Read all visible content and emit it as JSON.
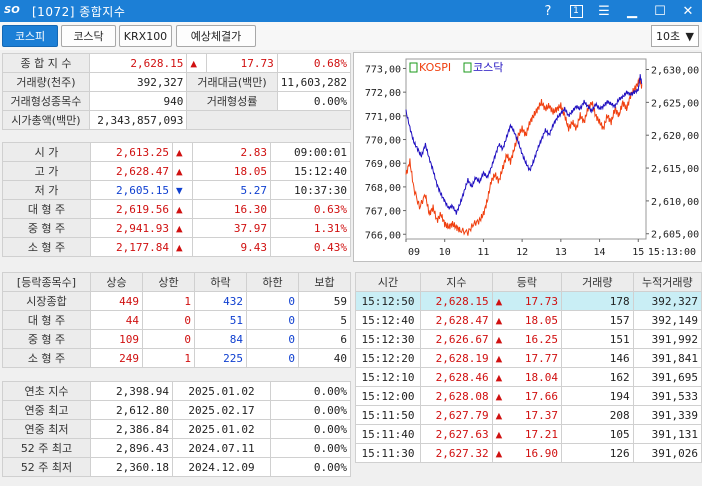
{
  "window": {
    "logo": "SO",
    "title": "[1072] 종합지수",
    "help": "?",
    "one": "1"
  },
  "tabs": [
    "코스피",
    "코스닥",
    "KRX100",
    "예상체결가"
  ],
  "interval": "10초",
  "summary": {
    "rows": [
      [
        "종 합 지 수",
        "2,628.15",
        "▲",
        "17.73",
        "0.68%"
      ],
      [
        "거래량(천주)",
        "392,327",
        "거래대금(백만)",
        "11,603,282"
      ],
      [
        "거래형성종목수",
        "940",
        "거래형성률",
        "0.00%"
      ],
      [
        "시가총액(백만)",
        "2,343,857,093"
      ]
    ]
  },
  "ohlc": [
    [
      "시      가",
      "2,613.25",
      "▲",
      "2.83",
      "09:00:01"
    ],
    [
      "고      가",
      "2,628.47",
      "▲",
      "18.05",
      "15:12:40"
    ],
    [
      "저      가",
      "2,605.15",
      "▼",
      "5.27",
      "10:37:30"
    ],
    [
      "대 형 주",
      "2,619.56",
      "▲",
      "16.30",
      "0.63%"
    ],
    [
      "중 형 주",
      "2,941.93",
      "▲",
      "37.97",
      "1.31%"
    ],
    [
      "소 형 주",
      "2,177.84",
      "▲",
      "9.43",
      "0.43%"
    ]
  ],
  "breadth": {
    "headers": [
      "[등락종목수]",
      "상승",
      "상한",
      "하락",
      "하한",
      "보합"
    ],
    "rows": [
      [
        "시장종합",
        "449",
        "1",
        "432",
        "0",
        "59"
      ],
      [
        "대 형 주",
        "44",
        "0",
        "51",
        "0",
        "5"
      ],
      [
        "중 형 주",
        "109",
        "0",
        "84",
        "0",
        "6"
      ],
      [
        "소 형 주",
        "249",
        "1",
        "225",
        "0",
        "40"
      ]
    ]
  },
  "annual": [
    [
      "연초  지수",
      "2,398.94",
      "2025.01.02",
      "0.00%"
    ],
    [
      "연중  최고",
      "2,612.80",
      "2025.02.17",
      "0.00%"
    ],
    [
      "연중  최저",
      "2,386.84",
      "2025.01.02",
      "0.00%"
    ],
    [
      "52 주 최고",
      "2,896.43",
      "2024.07.11",
      "0.00%"
    ],
    [
      "52 주 최저",
      "2,360.18",
      "2024.12.09",
      "0.00%"
    ]
  ],
  "ticks": {
    "headers": [
      "시간",
      "지수",
      "등락",
      "거래량",
      "누적거래량"
    ],
    "rows": [
      [
        "15:12:50",
        "2,628.15",
        "▲",
        "17.73",
        "178",
        "392,327"
      ],
      [
        "15:12:40",
        "2,628.47",
        "▲",
        "18.05",
        "157",
        "392,149"
      ],
      [
        "15:12:30",
        "2,626.67",
        "▲",
        "16.25",
        "151",
        "391,992"
      ],
      [
        "15:12:20",
        "2,628.19",
        "▲",
        "17.77",
        "146",
        "391,841"
      ],
      [
        "15:12:10",
        "2,628.46",
        "▲",
        "18.04",
        "162",
        "391,695"
      ],
      [
        "15:12:00",
        "2,628.08",
        "▲",
        "17.66",
        "194",
        "391,533"
      ],
      [
        "15:11:50",
        "2,627.79",
        "▲",
        "17.37",
        "208",
        "391,339"
      ],
      [
        "15:11:40",
        "2,627.63",
        "▲",
        "17.21",
        "105",
        "391,131"
      ],
      [
        "15:11:30",
        "2,627.32",
        "▲",
        "16.90",
        "126",
        "391,026"
      ]
    ]
  },
  "chart_data": {
    "type": "line",
    "legend": [
      "KOSPI",
      "코스닥"
    ],
    "series": [
      {
        "name": "KOSPI",
        "axis": "right",
        "color": "#f04010",
        "points": [
          [
            9.0,
            2614
          ],
          [
            9.1,
            2616
          ],
          [
            9.2,
            2612
          ],
          [
            9.35,
            2609
          ],
          [
            9.5,
            2611
          ],
          [
            9.6,
            2608
          ],
          [
            9.7,
            2609
          ],
          [
            9.8,
            2607
          ],
          [
            9.9,
            2608
          ],
          [
            10.0,
            2606.5
          ],
          [
            10.1,
            2606
          ],
          [
            10.2,
            2606.5
          ],
          [
            10.3,
            2606
          ],
          [
            10.4,
            2605.5
          ],
          [
            10.6,
            2605.2
          ],
          [
            10.75,
            2606.5
          ],
          [
            10.9,
            2607
          ],
          [
            11.0,
            2608
          ],
          [
            11.1,
            2610
          ],
          [
            11.2,
            2613
          ],
          [
            11.3,
            2614
          ],
          [
            11.4,
            2613
          ],
          [
            11.5,
            2615
          ],
          [
            11.6,
            2617
          ],
          [
            11.7,
            2616
          ],
          [
            11.8,
            2618
          ],
          [
            11.9,
            2620
          ],
          [
            12.0,
            2621
          ],
          [
            12.1,
            2620
          ],
          [
            12.2,
            2622
          ],
          [
            12.3,
            2623
          ],
          [
            12.4,
            2624
          ],
          [
            12.5,
            2625
          ],
          [
            12.6,
            2624
          ],
          [
            12.7,
            2624.5
          ],
          [
            12.8,
            2623.5
          ],
          [
            12.9,
            2624
          ],
          [
            13.0,
            2624.5
          ],
          [
            13.1,
            2623
          ],
          [
            13.2,
            2621
          ],
          [
            13.3,
            2622
          ],
          [
            13.4,
            2621
          ],
          [
            13.5,
            2623
          ],
          [
            13.6,
            2622
          ],
          [
            13.7,
            2624
          ],
          [
            13.8,
            2625
          ],
          [
            13.9,
            2623
          ],
          [
            14.0,
            2622
          ],
          [
            14.1,
            2621
          ],
          [
            14.2,
            2623
          ],
          [
            14.3,
            2622
          ],
          [
            14.4,
            2624
          ],
          [
            14.5,
            2623
          ],
          [
            14.6,
            2625
          ],
          [
            14.7,
            2624
          ],
          [
            14.8,
            2626
          ],
          [
            14.9,
            2627
          ],
          [
            15.0,
            2628
          ],
          [
            15.05,
            2628.5
          ],
          [
            15.1,
            2627
          ]
        ]
      },
      {
        "name": "코스닥",
        "axis": "left",
        "color": "#2010c0",
        "points": [
          [
            9.0,
            771.2
          ],
          [
            9.1,
            770.5
          ],
          [
            9.2,
            769.9
          ],
          [
            9.3,
            769.6
          ],
          [
            9.4,
            769.3
          ],
          [
            9.5,
            769.8
          ],
          [
            9.6,
            769.2
          ],
          [
            9.7,
            768.7
          ],
          [
            9.8,
            768.1
          ],
          [
            9.9,
            767.7
          ],
          [
            10.0,
            767.4
          ],
          [
            10.1,
            767.1
          ],
          [
            10.2,
            767.2
          ],
          [
            10.3,
            766.9
          ],
          [
            10.4,
            767.3
          ],
          [
            10.5,
            767.8
          ],
          [
            10.6,
            768.3
          ],
          [
            10.7,
            768.0
          ],
          [
            10.8,
            768.4
          ],
          [
            10.9,
            768.2
          ],
          [
            11.0,
            768.6
          ],
          [
            11.1,
            768.4
          ],
          [
            11.2,
            768.8
          ],
          [
            11.3,
            769.3
          ],
          [
            11.4,
            769.8
          ],
          [
            11.5,
            769.6
          ],
          [
            11.6,
            770.1
          ],
          [
            11.7,
            770.6
          ],
          [
            11.8,
            770.3
          ],
          [
            11.9,
            769.9
          ],
          [
            12.0,
            769.4
          ],
          [
            12.1,
            769.0
          ],
          [
            12.2,
            768.7
          ],
          [
            12.3,
            769.1
          ],
          [
            12.4,
            769.6
          ],
          [
            12.5,
            770.0
          ],
          [
            12.6,
            770.4
          ],
          [
            12.7,
            770.2
          ],
          [
            12.8,
            770.6
          ],
          [
            12.9,
            770.9
          ],
          [
            13.0,
            771.1
          ],
          [
            13.1,
            771.3
          ],
          [
            13.2,
            771.0
          ],
          [
            13.3,
            771.2
          ],
          [
            13.4,
            771.4
          ],
          [
            13.5,
            771.3
          ],
          [
            13.6,
            771.6
          ],
          [
            13.7,
            771.4
          ],
          [
            13.8,
            771.2
          ],
          [
            13.9,
            771.5
          ],
          [
            14.0,
            771.3
          ],
          [
            14.1,
            771.4
          ],
          [
            14.2,
            771.6
          ],
          [
            14.3,
            771.5
          ],
          [
            14.4,
            771.4
          ],
          [
            14.5,
            771.7
          ],
          [
            14.6,
            771.8
          ],
          [
            14.7,
            772.0
          ],
          [
            14.8,
            771.9
          ],
          [
            14.9,
            772.0
          ],
          [
            15.0,
            772.1
          ],
          [
            15.05,
            772.7
          ],
          [
            15.1,
            772.3
          ]
        ]
      }
    ],
    "x": {
      "range": [
        9,
        15.2
      ],
      "ticks": [
        "09",
        "10",
        "11",
        "12",
        "13",
        "14",
        "15",
        "15:13:00"
      ]
    },
    "y_left": {
      "range": [
        765.8,
        773.4
      ],
      "ticks": [
        "773,00",
        "772,00",
        "771,00",
        "770,00",
        "769,00",
        "768,00",
        "767,00",
        "766,00"
      ]
    },
    "y_right": {
      "range": [
        2604.2,
        2631.6
      ],
      "ticks": [
        "2,630,00",
        "2,625,00",
        "2,620,00",
        "2,615,00",
        "2,610,00",
        "2,605,00"
      ]
    }
  }
}
